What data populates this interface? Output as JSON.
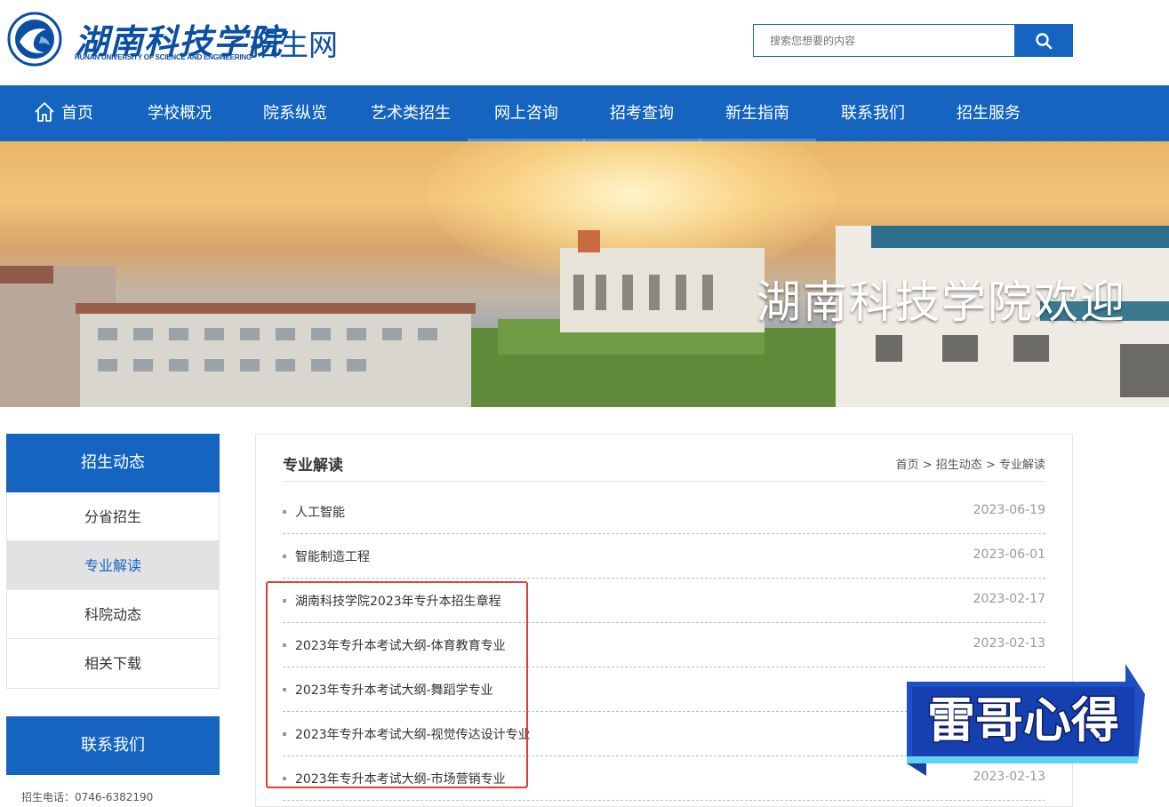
{
  "header": {
    "logo_cn": "湖南科技学院",
    "logo_en": "HUNAN UNIVERSITY OF SCIENCE AND ENGINEERING",
    "site_name": "招生网",
    "search_placeholder": "搜索您想要的内容",
    "search_icon": "search-icon"
  },
  "nav": {
    "items": [
      {
        "label": "首页",
        "icon": "home-icon"
      },
      {
        "label": "学校概况"
      },
      {
        "label": "院系纵览"
      },
      {
        "label": "艺术类招生"
      },
      {
        "label": "网上咨询"
      },
      {
        "label": "招考查询"
      },
      {
        "label": "新生指南"
      },
      {
        "label": "联系我们"
      },
      {
        "label": "招生服务"
      }
    ]
  },
  "banner": {
    "text": "湖南科技学院欢迎"
  },
  "sidebar": {
    "section1_title": "招生动态",
    "items": [
      {
        "label": "分省招生"
      },
      {
        "label": "专业解读",
        "active": true
      },
      {
        "label": "科院动态"
      },
      {
        "label": "相关下载"
      }
    ],
    "section2_title": "联系我们",
    "contact_tel": "招生电话：0746-6382190"
  },
  "content": {
    "title": "专业解读",
    "breadcrumb": [
      "首页",
      ">",
      "招生动态",
      ">",
      "专业解读"
    ],
    "articles": [
      {
        "title": "人工智能",
        "date": "2023-06-19"
      },
      {
        "title": "智能制造工程",
        "date": "2023-06-01"
      },
      {
        "title": "湖南科技学院2023年专升本招生章程",
        "date": "2023-02-17"
      },
      {
        "title": "2023年专升本考试大纲-体育教育专业",
        "date": "2023-02-13"
      },
      {
        "title": "2023年专升本考试大纲-舞蹈学专业",
        "date": ""
      },
      {
        "title": "2023年专升本考试大纲-视觉传达设计专业",
        "date": ""
      },
      {
        "title": "2023年专升本考试大纲-市场营销专业",
        "date": "2023-02-13"
      }
    ]
  },
  "watermark": {
    "text": "雷哥心得"
  },
  "colors": {
    "brand_blue": "#1565c0",
    "highlight_red": "#e53935"
  }
}
